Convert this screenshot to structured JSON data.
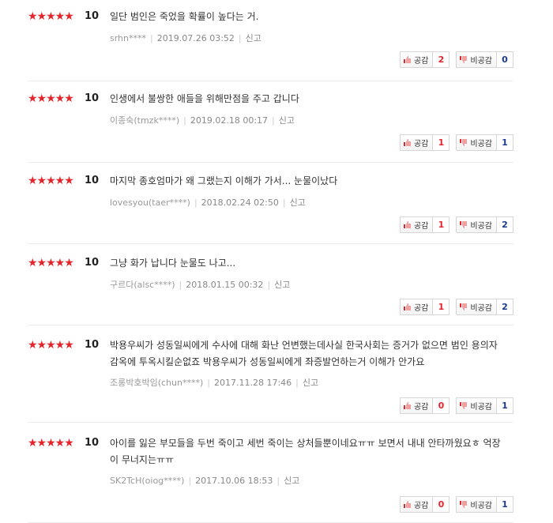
{
  "reviews": [
    {
      "stars": "★★★★★",
      "score": "10",
      "text": "일단 범인은 죽었을 확률이 높다는 거.",
      "user": "srhn****",
      "date": "2019.07.26 03:52",
      "report": "신고",
      "like_label": "공감",
      "like": "2",
      "dislike_label": "비공감",
      "dislike": "0"
    },
    {
      "stars": "★★★★★",
      "score": "10",
      "text": "인생에서 불쌍한 애들을 위해만점을 주고 갑니다",
      "user": "이종숙(tmzk****)",
      "date": "2019.02.18 00:17",
      "report": "신고",
      "like_label": "공감",
      "like": "1",
      "dislike_label": "비공감",
      "dislike": "1"
    },
    {
      "stars": "★★★★★",
      "score": "10",
      "text": "마지막 종호엄마가 왜 그랬는지 이해가 가서... 눈물이났다",
      "user": "lovesyou(taer****)",
      "date": "2018.02.24 02:50",
      "report": "신고",
      "like_label": "공감",
      "like": "1",
      "dislike_label": "비공감",
      "dislike": "2"
    },
    {
      "stars": "★★★★★",
      "score": "10",
      "text": "그냥 화가 납니다 눈물도 나고...",
      "user": "구르다(alsc****)",
      "date": "2018.01.15 00:32",
      "report": "신고",
      "like_label": "공감",
      "like": "1",
      "dislike_label": "비공감",
      "dislike": "2"
    },
    {
      "stars": "★★★★★",
      "score": "10",
      "text": "박용우씨가 성동일씨에게 수사에 대해 화난 언변했는데사실 한국사회는 증거가 없으면 범인 용의자 감옥에 투옥시킬순없죠 박용우씨가 성동일씨에게 좌증발언하는거 이해가 안가요",
      "user": "조롱박호박임(chun****)",
      "date": "2017.11.28 17:46",
      "report": "신고",
      "like_label": "공감",
      "like": "0",
      "dislike_label": "비공감",
      "dislike": "1"
    },
    {
      "stars": "★★★★★",
      "score": "10",
      "text": "아이를 잃은 부모들을 두번 죽이고 세번 죽이는 상처들뿐이네요ㅠㅠ 보면서 내내 안타까웠요ㅎ 억장이 무너지는ㅠㅠ",
      "user": "SK2TcH(oiog****)",
      "date": "2017.10.06 18:53",
      "report": "신고",
      "like_label": "공감",
      "like": "0",
      "dislike_label": "비공감",
      "dislike": "1"
    }
  ]
}
